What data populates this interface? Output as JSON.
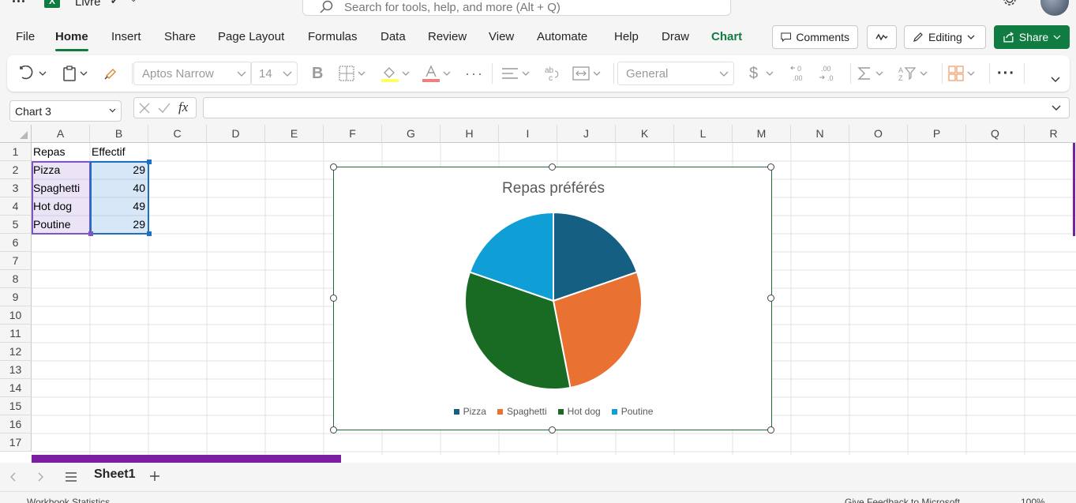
{
  "titlebar": {
    "doc_name": "Livre",
    "search_placeholder": "Search for tools, help, and more (Alt + Q)"
  },
  "menu": {
    "tabs": [
      "File",
      "Home",
      "Insert",
      "Share",
      "Page Layout",
      "Formulas",
      "Data",
      "Review",
      "View",
      "Automate",
      "Help",
      "Draw",
      "Chart"
    ],
    "active_tab": "Home",
    "comments_label": "Comments",
    "editing_label": "Editing",
    "share_label": "Share"
  },
  "ribbon": {
    "font_name": "Aptos Narrow",
    "font_size": "14",
    "number_format": "General",
    "currency_symbol": "$"
  },
  "formula_bar": {
    "name_box": "Chart 3",
    "fx_label": "fx",
    "formula": ""
  },
  "grid": {
    "columns": [
      "A",
      "B",
      "C",
      "D",
      "E",
      "F",
      "G",
      "H",
      "I",
      "J",
      "K",
      "L",
      "M",
      "N",
      "O",
      "P",
      "Q",
      "R"
    ],
    "rows": [
      "1",
      "2",
      "3",
      "4",
      "5",
      "6",
      "7",
      "8",
      "9",
      "10",
      "11",
      "12",
      "13",
      "14",
      "15",
      "16",
      "17"
    ],
    "headers": [
      "Repas",
      "Effectif"
    ],
    "data": [
      {
        "label": "Pizza",
        "value": "29"
      },
      {
        "label": "Spaghetti",
        "value": "40"
      },
      {
        "label": "Hot dog",
        "value": "49"
      },
      {
        "label": "Poutine",
        "value": "29"
      }
    ]
  },
  "chart_data": {
    "type": "pie",
    "title": "Repas préférés",
    "categories": [
      "Pizza",
      "Spaghetti",
      "Hot dog",
      "Poutine"
    ],
    "values": [
      29,
      40,
      49,
      29
    ],
    "colors": [
      "#156082",
      "#e97132",
      "#196b24",
      "#0f9ed5"
    ],
    "legend_position": "bottom"
  },
  "sheets": {
    "active": "Sheet1"
  },
  "status": {
    "left": "Workbook Statistics",
    "feedback": "Give Feedback to Microsoft",
    "zoom": "100%"
  }
}
